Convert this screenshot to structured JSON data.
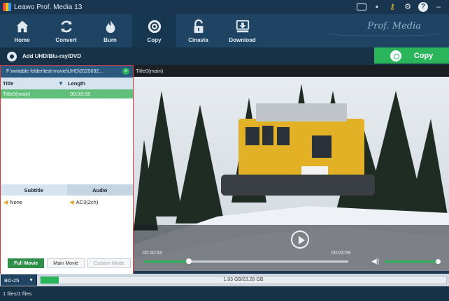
{
  "window": {
    "title": "Leawo Prof. Media 13"
  },
  "nav": {
    "items": [
      {
        "label": "Home",
        "icon": "home-icon"
      },
      {
        "label": "Convert",
        "icon": "convert-icon"
      },
      {
        "label": "Burn",
        "icon": "burn-icon"
      },
      {
        "label": "Copy",
        "icon": "copy-disc-icon",
        "active": true
      },
      {
        "label": "Cinavia",
        "icon": "cinavia-lock-icon"
      },
      {
        "label": "Download",
        "icon": "download-icon"
      }
    ],
    "brand": "Prof. Media"
  },
  "actions": {
    "add_disc_label": "Add UHD/Blu-ray/DVD",
    "copy_label": "Copy"
  },
  "left_panel": {
    "path": "F:\\writable folder\\test-movie\\UHD\\2025032...",
    "columns": {
      "title": "Title",
      "length": "Length"
    },
    "titles": [
      {
        "name": "Title0(main)",
        "length": "00:03:59",
        "selected": true
      }
    ],
    "subtitle_header": "Subtitle",
    "audio_header": "Audio",
    "subtitle_value": "None",
    "audio_value": "AC3(2ch)",
    "modes": {
      "full": "Full Movie",
      "main": "Main Movie",
      "custom": "Custom Mode"
    }
  },
  "preview": {
    "title": "Title0(main)",
    "time_current": "00:00:53",
    "time_total": "00:03:59",
    "seek_fraction": 0.22,
    "volume_fraction": 1.0
  },
  "capacity": {
    "disc_type": "BD-25",
    "text": "1.03 GB/23.28 GB",
    "used_fraction": 0.044
  },
  "status": {
    "files": "1 files/1 files"
  },
  "colors": {
    "accent_green": "#2bb55a",
    "nav_bg": "#1f4463",
    "selection": "#5fbf7a"
  }
}
